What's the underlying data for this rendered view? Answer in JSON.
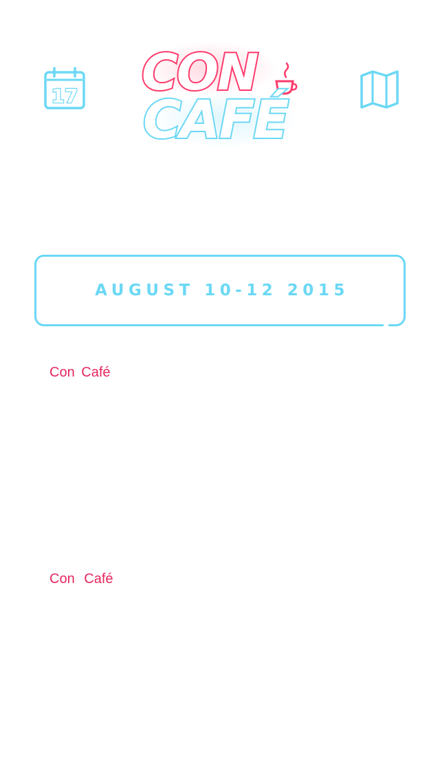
{
  "header": {
    "logo": {
      "line1": "CON",
      "line2": "CAFÉ",
      "pink": "#ff3a6c",
      "blue": "#6bd8f5"
    },
    "calendar_button": {
      "icon": "calendar-icon",
      "day": "17"
    },
    "map_button": {
      "icon": "map-icon"
    }
  },
  "date_banner": {
    "text": "AUGUST 10-12 2015",
    "color": "#6bd8f5"
  },
  "events": [
    {
      "title": "Con Café",
      "color": "#e6265e"
    },
    {
      "title": "Con Café",
      "color": "#e6265e"
    }
  ]
}
